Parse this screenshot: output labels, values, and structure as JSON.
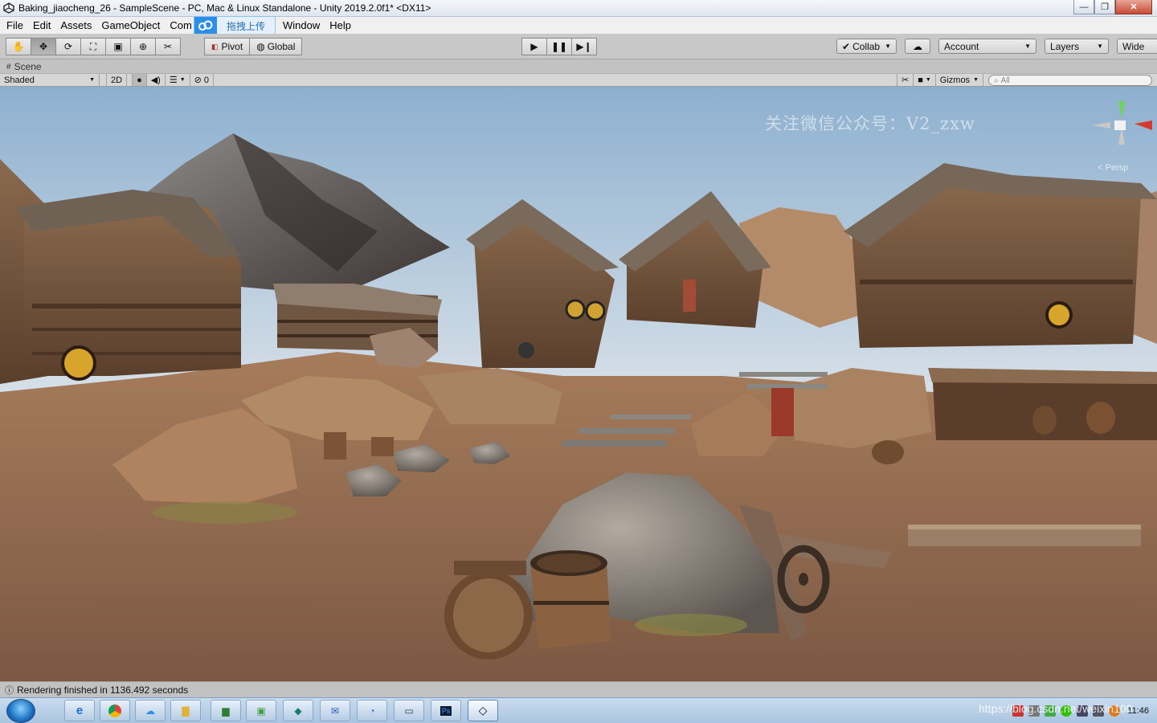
{
  "window": {
    "title": "Baking_jiaocheng_26 - SampleScene - PC, Mac & Linux Standalone - Unity 2019.2.0f1* <DX11>",
    "minimize": "—",
    "maximize": "❐",
    "close": "✕"
  },
  "menu": {
    "items": [
      "File",
      "Edit",
      "Assets",
      "GameObject",
      "Com"
    ],
    "items_after": [
      "Window",
      "Help"
    ],
    "upload_label": "拖拽上传"
  },
  "toolbar": {
    "pivot": "Pivot",
    "global": "Global",
    "collab": "Collab",
    "account": "Account",
    "layers": "Layers",
    "layout": "Wide"
  },
  "scene": {
    "tab": "Scene",
    "shading": "Shaded",
    "mode_2d": "2D",
    "hidden_count": "0",
    "gizmos": "Gizmos",
    "search_placeholder": "All",
    "watermark": "关注微信公众号：V2_zxw",
    "persp": "< Persp"
  },
  "status": {
    "message": "Rendering finished in 1136.492 seconds"
  },
  "taskbar": {
    "clock": "11:46",
    "blog_watermark": "https://blog.csdn.net/weixin100"
  },
  "colors": {
    "sky_top": "#8fb0cd",
    "sky_bottom": "#d9e2e8",
    "ground": "#8e6448",
    "wood": "#6b4a32"
  }
}
